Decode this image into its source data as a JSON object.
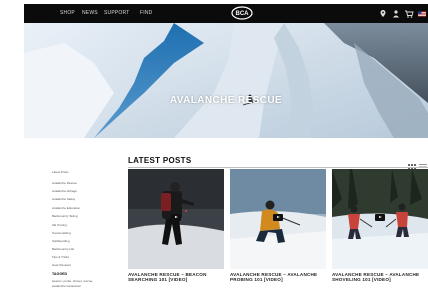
{
  "nav": {
    "items": [
      "SHOP",
      "NEWS",
      "SUPPORT",
      "FIND"
    ],
    "logo_text": "BCA",
    "icons": [
      "location-icon",
      "user-icon",
      "cart-icon",
      "flag-icon"
    ]
  },
  "hero": {
    "title": "AVALANCHE RESCUE"
  },
  "main": {
    "title": "LATEST POSTS"
  },
  "sidebar": {
    "categories": [
      "Latest Posts",
      "Avalanche Rescue",
      "Avalanche Airbags",
      "Avalanche Safety",
      "Avalanche Education",
      "Backcountry Skiing",
      "Ski Touring",
      "Snowmobiling",
      "Splitboarding",
      "Backcountry Life",
      "Tips & Tricks",
      "Gear Reviews"
    ],
    "tagged_title": "TAGGED",
    "tagged_text": [
      "beacon, probe, shovel, rescue,",
      "avalanche transceiver"
    ]
  },
  "posts": [
    {
      "title": "AVALANCHE RESCUE – BEACON SEARCHING 101 [VIDEO]"
    },
    {
      "title": "AVALANCHE RESCUE – AVALANCHE PROBING 101 [VIDEO]"
    },
    {
      "title": "AVALANCHE RESCUE – AVALANCHE SHOVELING 101 [VIDEO]"
    }
  ]
}
